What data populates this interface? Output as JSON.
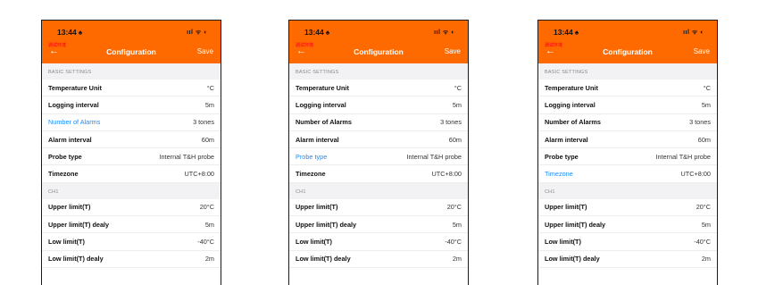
{
  "status": {
    "time": "13:44",
    "time_suffix": "♠",
    "icons": "ııl ᯤ ◐"
  },
  "header": {
    "tiny_text": "调试环境",
    "back": "←",
    "title": "Configuration",
    "save": "Save"
  },
  "sections": {
    "basic": "BASIC SETTINGS",
    "ch1": "CH1"
  },
  "basic_rows": [
    {
      "label": "Temperature Unit",
      "value": "°C"
    },
    {
      "label": "Logging interval",
      "value": "5m"
    },
    {
      "label": "Number of Alarms",
      "value": "3 tones"
    },
    {
      "label": "Alarm interval",
      "value": "60m"
    },
    {
      "label": "Probe type",
      "value": "Internal T&H probe"
    },
    {
      "label": "Timezone",
      "value": "UTC+8:00"
    }
  ],
  "ch1_rows": [
    {
      "label": "Upper limit(T)",
      "value": "20°C"
    },
    {
      "label": "Upper limit(T) dealy",
      "value": "5m"
    },
    {
      "label": "Low limit(T)",
      "value": "-40°C"
    },
    {
      "label": "Low limit(T) dealy",
      "value": "2m"
    }
  ],
  "phones": [
    {
      "highlighted_row": 2
    },
    {
      "highlighted_row": 4
    },
    {
      "highlighted_row": 5
    }
  ],
  "colors": {
    "header_orange": "#ff6a00",
    "highlight_blue": "#1a8cff"
  }
}
